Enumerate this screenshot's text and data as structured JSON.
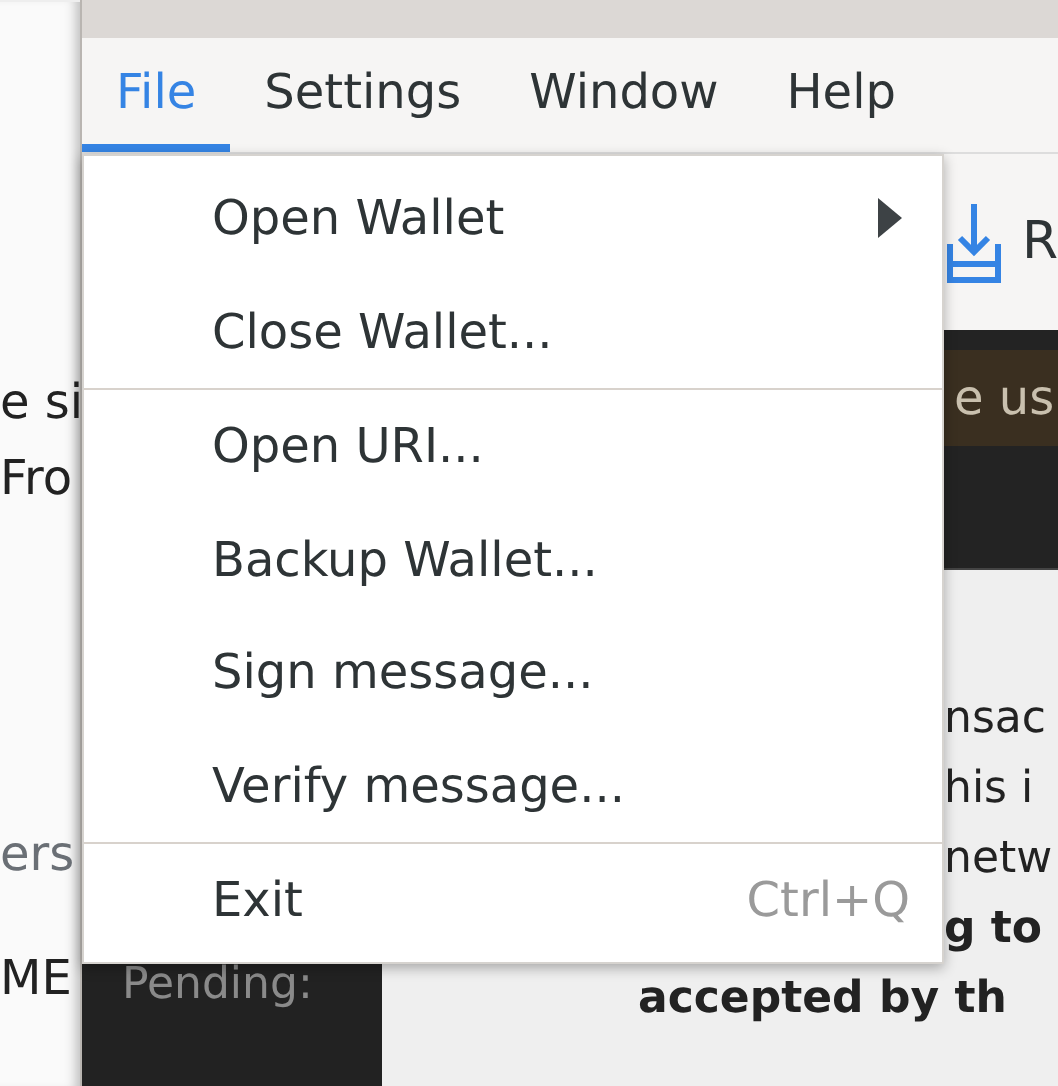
{
  "behind_left": {
    "texts": [
      {
        "text": "e si",
        "muted": false
      },
      {
        "text": "Fro",
        "muted": false
      },
      {
        "text": "ers",
        "muted": true
      },
      {
        "text": "ME",
        "muted": false
      }
    ]
  },
  "menubar": [
    {
      "label": "File",
      "selected": true
    },
    {
      "label": "Settings",
      "selected": false
    },
    {
      "label": "Window",
      "selected": false
    },
    {
      "label": "Help",
      "selected": false
    }
  ],
  "menu": [
    {
      "kind": "item",
      "label": "Open Wallet",
      "submenu": true
    },
    {
      "kind": "item",
      "label": "Close Wallet..."
    },
    {
      "kind": "separator"
    },
    {
      "kind": "item",
      "label": "Open URI..."
    },
    {
      "kind": "item",
      "label": "Backup Wallet..."
    },
    {
      "kind": "item",
      "label": "Sign message..."
    },
    {
      "kind": "item",
      "label": "Verify message..."
    },
    {
      "kind": "separator"
    },
    {
      "kind": "item",
      "label": "Exit",
      "shortcut": "Ctrl+Q"
    }
  ],
  "toolbar": {
    "button_label": "R"
  },
  "banner": {
    "text": "e us"
  },
  "content": {
    "lines": [
      {
        "text": "nsac",
        "bold": false
      },
      {
        "text": "his i",
        "bold": false
      },
      {
        "text": "netw",
        "bold": false
      },
      {
        "text": "g to",
        "bold": true
      },
      {
        "text": "accepted by th",
        "bold": true
      }
    ],
    "pending_label": "Pending:"
  }
}
